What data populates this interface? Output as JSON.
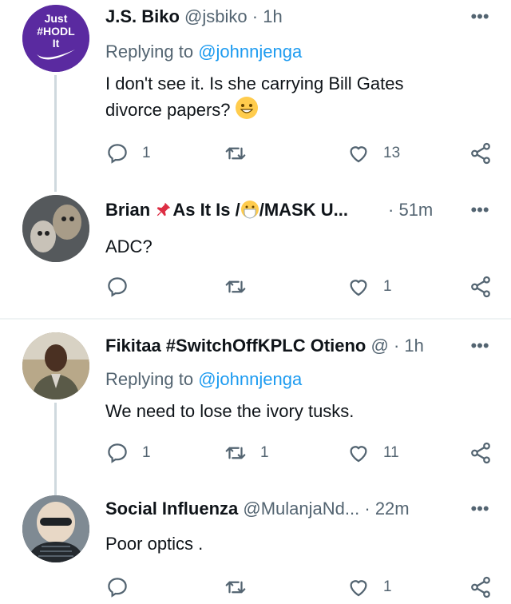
{
  "tweets": [
    {
      "name": "J.S. Biko",
      "handle": "@jsbiko",
      "dot": "·",
      "time": "1h",
      "replying_prefix": "Replying to",
      "replying_to": "@johnnjenga",
      "text_line1": "I don't see it. Is she carrying Bill Gates",
      "text_line2": "divorce papers?",
      "avatar_text_line1": "Just",
      "avatar_text_line2": "#HODL",
      "avatar_text_line3": "It",
      "reply_count": "1",
      "retweet_count": "",
      "like_count": "13"
    },
    {
      "name": "Brian",
      "name_suffix": "As It Is /",
      "name_suffix2": "/MASK U...",
      "dot": "·",
      "time": "51m",
      "text": "ADC?",
      "reply_count": "",
      "retweet_count": "",
      "like_count": "1"
    },
    {
      "name": "Fikitaa #SwitchOffKPLC Otieno",
      "handle": "@",
      "dot": "·",
      "time": "1h",
      "replying_prefix": "Replying to",
      "replying_to": "@johnnjenga",
      "text": "We need to lose the ivory tusks.",
      "reply_count": "1",
      "retweet_count": "1",
      "like_count": "11"
    },
    {
      "name": "Social Influenza",
      "handle": "@MulanjaNd...",
      "dot": "·",
      "time": "22m",
      "text": "Poor optics .",
      "reply_count": "",
      "retweet_count": "",
      "like_count": "1"
    }
  ],
  "more_glyph": "•••",
  "colors": {
    "link": "#1d9bf0",
    "muted": "#536471",
    "line": "#cfd9de",
    "purple": "#5a2aa0"
  }
}
